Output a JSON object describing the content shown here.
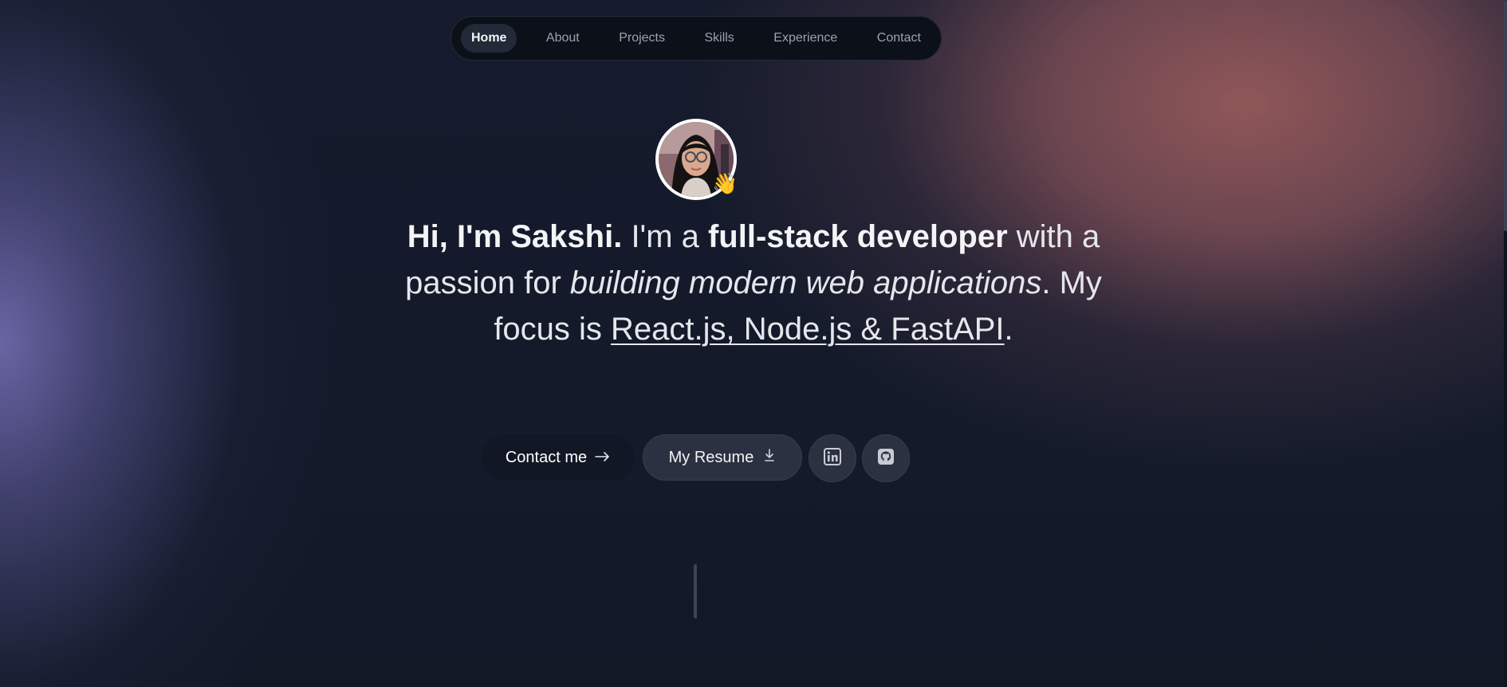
{
  "nav": {
    "items": [
      {
        "label": "Home",
        "active": true
      },
      {
        "label": "About",
        "active": false
      },
      {
        "label": "Projects",
        "active": false
      },
      {
        "label": "Skills",
        "active": false
      },
      {
        "label": "Experience",
        "active": false
      },
      {
        "label": "Contact",
        "active": false
      }
    ]
  },
  "hero": {
    "avatar_icon": "profile-photo",
    "wave_emoji": "👋",
    "headline": {
      "greeting": "Hi, I'm Sakshi.",
      "intro": " I'm a ",
      "role": "full-stack developer",
      "passion": " with a passion for ",
      "passion_focus": "building modern web applications",
      "focus_prefix": ". My focus is ",
      "focus_stack": "React.js, Node.js & FastAPI",
      "end": "."
    },
    "contact_button": {
      "label": "Contact me",
      "icon": "arrow-right-icon"
    },
    "resume_button": {
      "label": "My Resume",
      "icon": "download-icon"
    },
    "social": [
      {
        "name": "LinkedIn",
        "icon": "linkedin-icon"
      },
      {
        "name": "GitHub",
        "icon": "github-icon"
      }
    ]
  },
  "colors": {
    "background": "#121826",
    "nav_background": "#0b1019",
    "button_background": "#2b3140",
    "text": "#e5e7eb",
    "left_glow": "#6e69aa",
    "right_glow": "#965a5a"
  }
}
